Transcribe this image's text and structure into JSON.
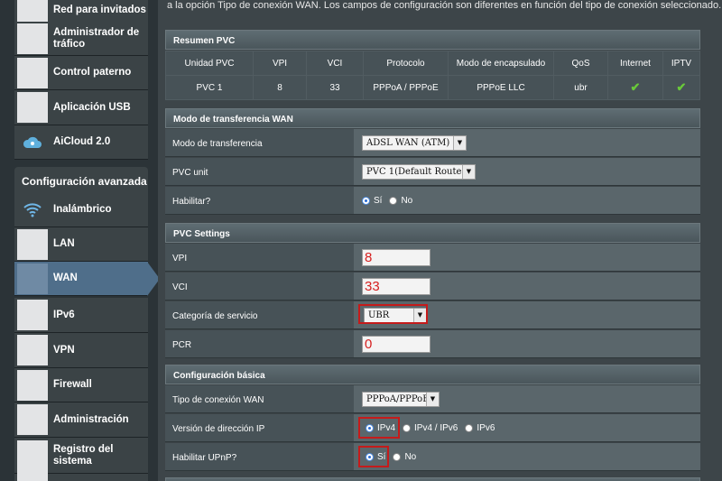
{
  "sidebar": {
    "general_items": [
      {
        "label": "Red para invitados",
        "icon": "guest-network-icon"
      },
      {
        "label": "Administrador de tráfico",
        "icon": "traffic-manager-icon"
      },
      {
        "label": "Control paterno",
        "icon": "parental-control-icon"
      },
      {
        "label": "Aplicación USB",
        "icon": "usb-app-icon"
      },
      {
        "label": "AiCloud 2.0",
        "icon": "cloud-icon"
      }
    ],
    "advanced_title": "Configuración avanzada",
    "advanced_items": [
      {
        "label": "Inalámbrico",
        "icon": "wifi-icon"
      },
      {
        "label": "LAN",
        "icon": "lan-icon"
      },
      {
        "label": "WAN",
        "icon": "wan-icon",
        "active": true
      },
      {
        "label": "IPv6",
        "icon": "ipv6-icon"
      },
      {
        "label": "VPN",
        "icon": "vpn-icon"
      },
      {
        "label": "Firewall",
        "icon": "firewall-icon"
      },
      {
        "label": "Administración",
        "icon": "admin-icon"
      },
      {
        "label": "Registro del sistema",
        "icon": "system-log-icon"
      }
    ]
  },
  "main": {
    "intro": "a la opción Tipo de conexión WAN. Los campos de configuración son diferentes en función del tipo de conexión seleccionado.",
    "pvc_summary": {
      "title": "Resumen PVC",
      "headers": [
        "Unidad PVC",
        "VPI",
        "VCI",
        "Protocolo",
        "Modo de encapsulado",
        "QoS",
        "Internet",
        "IPTV"
      ],
      "row": [
        "PVC 1",
        "8",
        "33",
        "PPPoA / PPPoE",
        "PPPoE LLC",
        "ubr"
      ]
    },
    "transfer": {
      "title": "Modo de transferencia WAN",
      "mode_label": "Modo de transferencia",
      "mode_value": "ADSL WAN (ATM)",
      "pvc_label": "PVC unit",
      "pvc_value": "PVC 1(Default Route)",
      "enable_label": "Habilitar?",
      "yes": "Sí",
      "no": "No"
    },
    "pvc_settings": {
      "title": "PVC Settings",
      "vpi_label": "VPI",
      "vpi_value": "8",
      "vci_label": "VCI",
      "vci_value": "33",
      "service_label": "Categoría de servicio",
      "service_value": "UBR",
      "pcr_label": "PCR",
      "pcr_value": "0"
    },
    "basic": {
      "title": "Configuración básica",
      "conn_label": "Tipo de conexión WAN",
      "conn_value": "PPPoA/PPPoE",
      "ip_label": "Versión de dirección IP",
      "ip_opt1": "IPv4",
      "ip_opt2": "IPv4 / IPv6",
      "ip_opt3": "IPv6",
      "upnp_label": "Habilitar UPnP?",
      "yes": "Sí",
      "no": "No"
    }
  }
}
